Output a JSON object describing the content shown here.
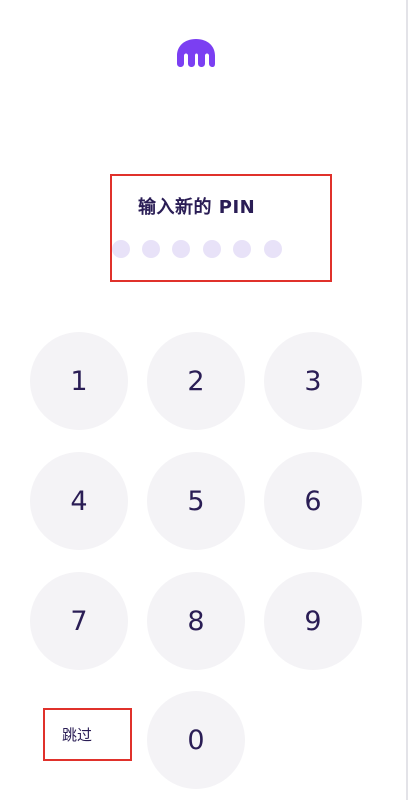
{
  "logo": {
    "icon": "kraken-logo-icon",
    "color": "#7b3ff2"
  },
  "pin": {
    "title": "输入新的 PIN",
    "digits_total": 6,
    "digits_entered": 0
  },
  "keypad": {
    "keys": [
      "1",
      "2",
      "3",
      "4",
      "5",
      "6",
      "7",
      "8",
      "9",
      "0"
    ],
    "skip_label": "跳过"
  },
  "colors": {
    "accent": "#7b3ff2",
    "text": "#2a1d55",
    "dot_empty": "#e8e2f8",
    "key_bg": "#f4f3f6",
    "highlight": "#e0312b"
  }
}
